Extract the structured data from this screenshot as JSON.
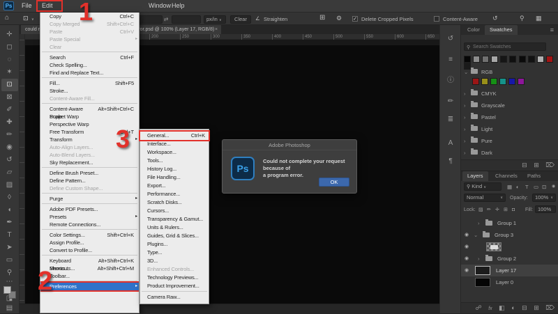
{
  "menubar": {
    "logo": "Ps",
    "items": [
      "File",
      "Edit",
      "Window",
      "Help"
    ]
  },
  "options_bar": {
    "unit": "px/in",
    "clear": "Clear",
    "straighten": "Straighten",
    "delete_cropped": "Delete Cropped Pixels",
    "content_aware": "Content-Aware"
  },
  "document_tab": {
    "left": "could n",
    "right": "rror.psd @ 100% (Layer 17, RGB/8)"
  },
  "ruler": {
    "ticks": [
      "200",
      "250",
      "300",
      "350",
      "400",
      "450",
      "500",
      "550",
      "600",
      "650"
    ]
  },
  "edit_menu": {
    "items": [
      {
        "label": "Copy",
        "shortcut": "Ctrl+C"
      },
      {
        "label": "Copy Merged",
        "shortcut": "Shift+Ctrl+C",
        "disabled": true
      },
      {
        "label": "Paste",
        "shortcut": "Ctrl+V",
        "disabled": true
      },
      {
        "label": "Paste Special",
        "submenu": true,
        "disabled": true
      },
      {
        "label": "Clear",
        "disabled": true
      },
      {
        "label": "Search",
        "shortcut": "Ctrl+F"
      },
      {
        "label": "Check Spelling..."
      },
      {
        "label": "Find and Replace Text..."
      },
      {
        "label": "Fill...",
        "shortcut": "Shift+F5"
      },
      {
        "label": "Stroke..."
      },
      {
        "label": "Content-Aware Fill...",
        "disabled": true
      },
      {
        "label": "Content-Aware Scale",
        "shortcut": "Alt+Shift+Ctrl+C"
      },
      {
        "label": "Puppet Warp"
      },
      {
        "label": "Perspective Warp"
      },
      {
        "label": "Free Transform",
        "shortcut": "Ctrl+T"
      },
      {
        "label": "Transform",
        "submenu": true
      },
      {
        "label": "Auto-Align Layers...",
        "disabled": true
      },
      {
        "label": "Auto-Blend Layers...",
        "disabled": true
      },
      {
        "label": "Sky Replacement..."
      },
      {
        "label": "Define Brush Preset..."
      },
      {
        "label": "Define Pattern..."
      },
      {
        "label": "Define Custom Shape...",
        "disabled": true
      },
      {
        "label": "Purge",
        "submenu": true
      },
      {
        "label": "Adobe PDF Presets..."
      },
      {
        "label": "Presets",
        "submenu": true
      },
      {
        "label": "Remote Connections..."
      },
      {
        "label": "Color Settings...",
        "shortcut": "Shift+Ctrl+K"
      },
      {
        "label": "Assign Profile..."
      },
      {
        "label": "Convert to Profile..."
      },
      {
        "label": "Keyboard Shortcuts...",
        "shortcut": "Alt+Shift+Ctrl+K"
      },
      {
        "label": "Menus...",
        "shortcut": "Alt+Shift+Ctrl+M"
      },
      {
        "label": "Toolbar..."
      },
      {
        "label": "Preferences",
        "submenu": true,
        "highlighted": true
      }
    ]
  },
  "preferences_submenu": {
    "items": [
      {
        "label": "General...",
        "shortcut": "Ctrl+K"
      },
      {
        "label": "Interface..."
      },
      {
        "label": "Workspace..."
      },
      {
        "label": "Tools..."
      },
      {
        "label": "History Log..."
      },
      {
        "label": "File Handling..."
      },
      {
        "label": "Export..."
      },
      {
        "label": "Performance..."
      },
      {
        "label": "Scratch Disks..."
      },
      {
        "label": "Cursors..."
      },
      {
        "label": "Transparency & Gamut..."
      },
      {
        "label": "Units & Rulers..."
      },
      {
        "label": "Guides, Grid & Slices..."
      },
      {
        "label": "Plugins..."
      },
      {
        "label": "Type..."
      },
      {
        "label": "3D..."
      },
      {
        "label": "Enhanced Controls...",
        "disabled": true
      },
      {
        "label": "Technology Previews..."
      },
      {
        "label": "Product Improvement..."
      },
      {
        "label": "Camera Raw..."
      }
    ]
  },
  "dialog": {
    "title": "Adobe Photoshop",
    "icon_text": "Ps",
    "message_line1": "Could not complete your request because of",
    "message_line2": "a program error.",
    "ok": "OK"
  },
  "annotations": {
    "step1": "1",
    "step2": "2",
    "step3": "3"
  },
  "panels": {
    "swatches": {
      "tabs": [
        "Color",
        "Swatches"
      ],
      "search_placeholder": "Search Swatches",
      "recent": [
        "#060606",
        "#8c8c8c",
        "#707070",
        "#a8a8a8",
        "#161616",
        "#101010",
        "#0b0b0b",
        "#121212",
        "#b0b0b0",
        "#a31414",
        "#1a1a1a"
      ],
      "rgb_colors": [
        "#9b1616",
        "#99901a",
        "#169016",
        "#15928a",
        "#1717a8",
        "#8e169b"
      ],
      "groups": [
        "RGB",
        "CMYK",
        "Grayscale",
        "Pastel",
        "Light",
        "Pure",
        "Dark"
      ]
    },
    "layers": {
      "tabs": [
        "Layers",
        "Channels",
        "Paths"
      ],
      "kind": "Kind",
      "blend_mode": "Normal",
      "opacity_label": "Opacity:",
      "opacity": "100%",
      "lock_label": "Lock:",
      "fill_label": "Fill:",
      "fill": "100%",
      "rows": [
        {
          "name": "Group 1"
        },
        {
          "name": "Group 3"
        },
        {
          "name": ""
        },
        {
          "name": "Group 2"
        },
        {
          "name": "Layer 17"
        },
        {
          "name": "Layer 0"
        }
      ]
    }
  },
  "colors": {
    "menu_highlight": "#2f72c9",
    "annotation_red": "#e2312b",
    "dialog_ok_blue": "#3c68ac",
    "ps_blue": "#31a8ff"
  },
  "icons": {
    "submenu_arrow": "▸",
    "eye": "◉",
    "search": "⚲",
    "panel_menu": "≡",
    "close": "×",
    "home": "⌂",
    "swap": "⇄",
    "gear": "⚙",
    "overlay_grid": "⊞",
    "straighten": "∠",
    "reset": "↺",
    "chevron_down": "⌄",
    "chevron_right": "›",
    "dropdown": "∨",
    "check": "✓",
    "workspace": "▦",
    "toolbar": [
      "✛",
      "◻",
      "◌",
      "✶",
      "⊡",
      "⊠",
      "✐",
      "✚",
      "✏",
      "◉",
      "↺",
      "▱",
      "▨",
      "◊",
      "◖",
      "✒",
      "T",
      "➤",
      "▭",
      "⚲",
      "⋯",
      "◨",
      "▤"
    ],
    "dock": [
      "↺",
      "≡",
      "ⓘ",
      "✏",
      "≣",
      "A",
      "¶"
    ],
    "layer_filter": [
      "▦",
      "◐",
      "T",
      "▭",
      "⊡",
      "◉"
    ],
    "lock": [
      "▨",
      "✏",
      "✛",
      "⊞",
      "◘"
    ],
    "layers_footer": [
      "☍",
      "fx",
      "◧",
      "◐",
      "⊟",
      "⊞",
      "⌦"
    ],
    "swatches_footer": [
      "⊟",
      "⊞",
      "⌦"
    ]
  }
}
